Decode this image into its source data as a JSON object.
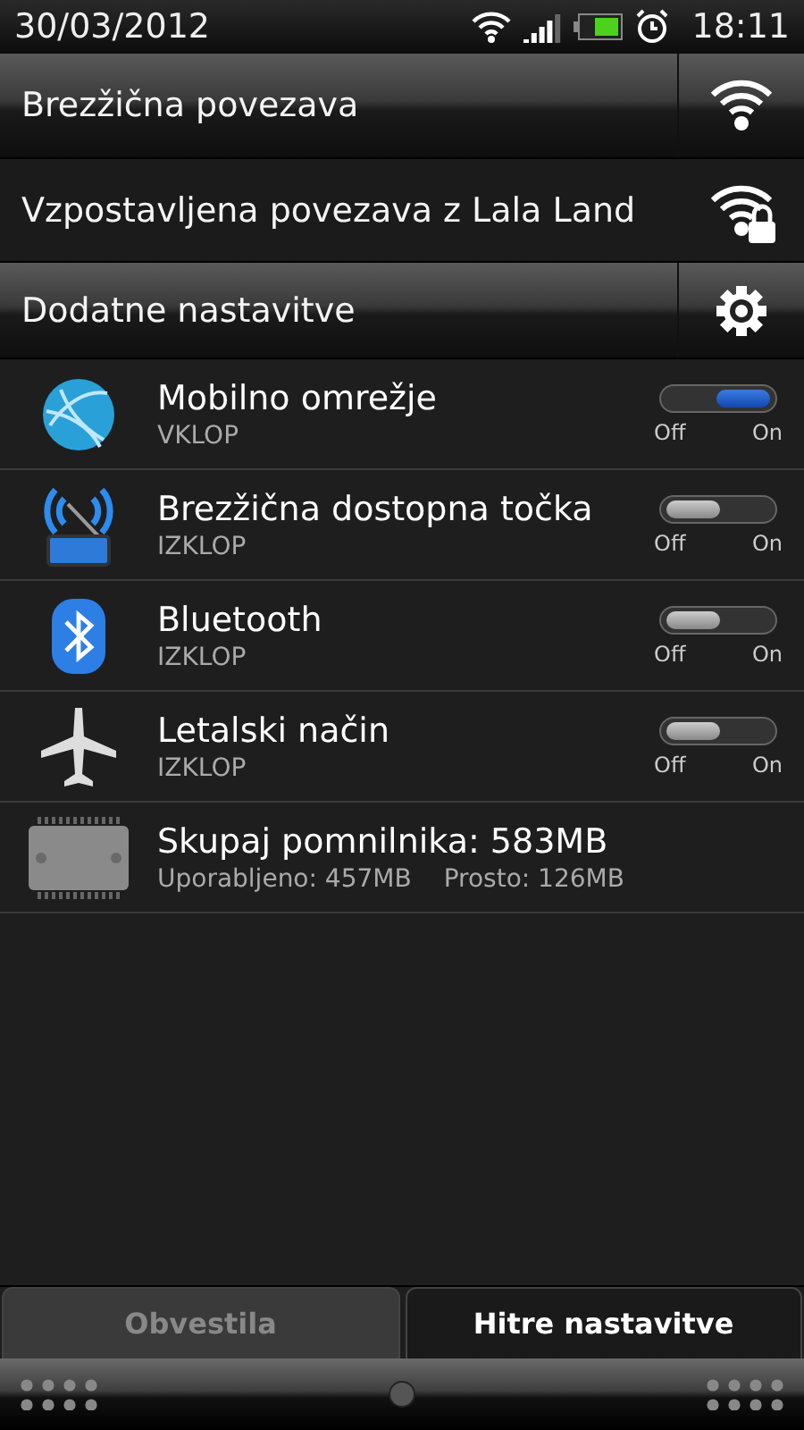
{
  "status_bar": {
    "date": "30/03/2012",
    "time": "18:11"
  },
  "headers": [
    {
      "kind": "wifi",
      "label": "Brezžična povezava"
    },
    {
      "kind": "connection",
      "label": "Vzpostavljena povezava z",
      "network": "Lala Land"
    },
    {
      "kind": "settings",
      "label": "Dodatne nastavitve"
    }
  ],
  "items": [
    {
      "kind": "toggle",
      "title": "Mobilno omrežje",
      "status": "VKLOP",
      "on": true,
      "off_label": "Off",
      "on_label": "On"
    },
    {
      "kind": "toggle",
      "title": "Brezžična dostopna točka",
      "status": "IZKLOP",
      "on": false,
      "off_label": "Off",
      "on_label": "On"
    },
    {
      "kind": "toggle",
      "title": "Bluetooth",
      "status": "IZKLOP",
      "on": false,
      "off_label": "Off",
      "on_label": "On"
    },
    {
      "kind": "toggle",
      "title": "Letalski način",
      "status": "IZKLOP",
      "on": false,
      "off_label": "Off",
      "on_label": "On"
    },
    {
      "kind": "storage",
      "title": "Skupaj pomnilnika: 583MB",
      "used": "Uporabljeno: 457MB",
      "free": "Prosto: 126MB"
    }
  ],
  "tabs": [
    {
      "label": "Obvestila",
      "selected": false
    },
    {
      "label": "Hitre nastavitve",
      "selected": true
    }
  ]
}
